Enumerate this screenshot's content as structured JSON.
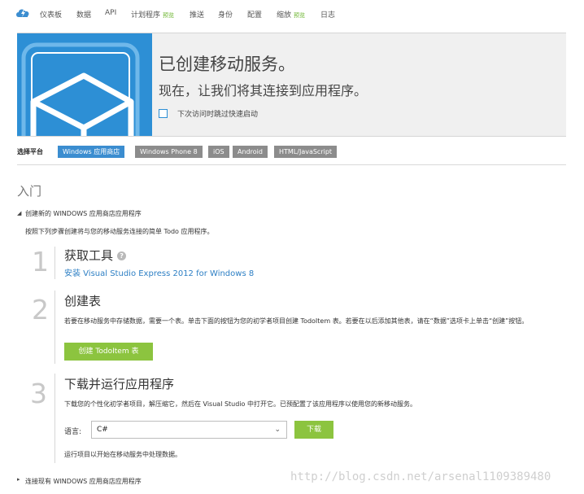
{
  "nav": {
    "items": [
      {
        "label": "仪表板"
      },
      {
        "label": "数据"
      },
      {
        "label": "API"
      },
      {
        "label": "计划程序",
        "tag": "预览"
      },
      {
        "label": "推送"
      },
      {
        "label": "身份"
      },
      {
        "label": "配置"
      },
      {
        "label": "缩放",
        "tag": "预览"
      },
      {
        "label": "日志"
      }
    ]
  },
  "hero": {
    "title": "已创建移动服务。",
    "subtitle": "现在，让我们将其连接到应用程序。",
    "skip_label": "下次访问时跳过快速启动"
  },
  "platforms": {
    "label": "选择平台",
    "tabs": [
      "Windows 应用商店",
      "Windows Phone 8",
      "iOS",
      "Android",
      "HTML/JavaScript"
    ],
    "active_index": 0
  },
  "section": {
    "intro": "入门",
    "create_new": "创建新的 WINDOWS 应用商店应用程序",
    "desc": "按照下列步骤创建将与您的移动服务连接的简单 Todo 应用程序。",
    "connect_existing": "连接现有 WINDOWS 应用商店应用程序"
  },
  "steps": [
    {
      "num": "1",
      "title": "获取工具",
      "link": "安装 Visual Studio Express 2012 for Windows 8"
    },
    {
      "num": "2",
      "title": "创建表",
      "text": "若要在移动服务中存储数据，需要一个表。单击下面的按钮为您的初学者项目创建 TodoItem 表。若要在以后添加其他表，请在“数据”选项卡上单击“创建”按钮。",
      "button": "创建 TodoItem 表"
    },
    {
      "num": "3",
      "title": "下载并运行应用程序",
      "text": "下载您的个性化初学者项目，解压缩它，然后在 Visual Studio 中打开它。已预配置了该应用程序以使用您的新移动服务。",
      "lang_label": "语言:",
      "lang_value": "C#",
      "download": "下载",
      "note": "运行项目以开始在移动服务中处理数据。"
    }
  ],
  "watermark": "http://blog.csdn.net/arsenal1109389480"
}
